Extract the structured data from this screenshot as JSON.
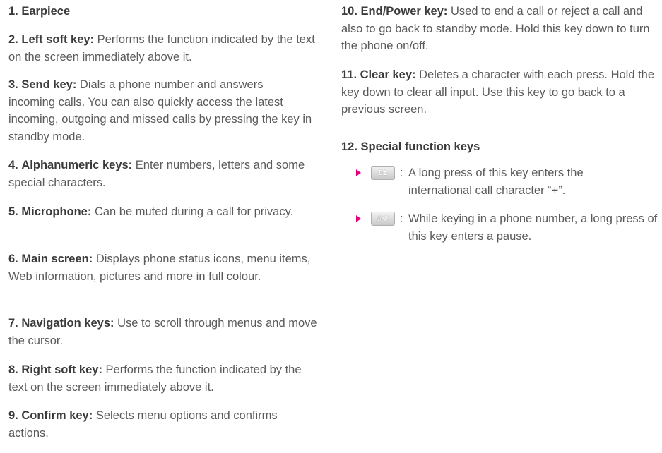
{
  "left_items": [
    {
      "num": "1.",
      "term": "Earpiece",
      "desc": ""
    },
    {
      "num": "2.",
      "term": "Left soft key:",
      "desc": "Performs the function indicated by the text on the screen immediately above it."
    },
    {
      "num": "3.",
      "term": "Send key:",
      "desc": "Dials a phone number and answers incoming calls. You can also quickly access the latest incoming, outgoing and missed calls by pressing the key in standby mode."
    },
    {
      "num": "4.",
      "term": "Alphanumeric keys:",
      "desc": "Enter numbers, letters and some special characters."
    },
    {
      "num": "5.",
      "term": "Microphone:",
      "desc": "Can be muted during a call for privacy."
    },
    {
      "num": "6.",
      "term": "Main screen:",
      "desc": "Displays phone status icons, menu items, Web information, pictures and more in full colour."
    },
    {
      "num": "7.",
      "term": "Navigation keys:",
      "desc": "Use to scroll through menus and move the cursor."
    },
    {
      "num": "8.",
      "term": "Right soft key:",
      "desc": "Performs the function indicated by the text on the screen immediately above it."
    },
    {
      "num": "9.",
      "term": "Confirm key:",
      "desc": "Selects menu options and confirms actions."
    }
  ],
  "right_items": [
    {
      "num": "10.",
      "term": "End/Power key:",
      "desc": "Used to end a call or reject a call and also to go back to standby mode. Hold this key down to turn the phone on/off."
    },
    {
      "num": "11.",
      "term": "Clear key:",
      "desc": "Deletes a character with each press. Hold the key down to clear all input. Use this key to go back to a previous screen."
    },
    {
      "num": "12.",
      "term": "Special function keys",
      "desc": ""
    }
  ],
  "special_keys": [
    {
      "icon": "zero-key-icon",
      "key_label": "0±",
      "text": "A long press of this key enters the international call character “+”."
    },
    {
      "icon": "hash-key-icon",
      "key_label": "#↺",
      "text": "While keying in a phone number, a long press of this key enters a pause."
    }
  ],
  "colon": ":",
  "colors": {
    "bullet": "#e4007c",
    "term": "#3a3a3a",
    "body": "#5a5a5a"
  }
}
